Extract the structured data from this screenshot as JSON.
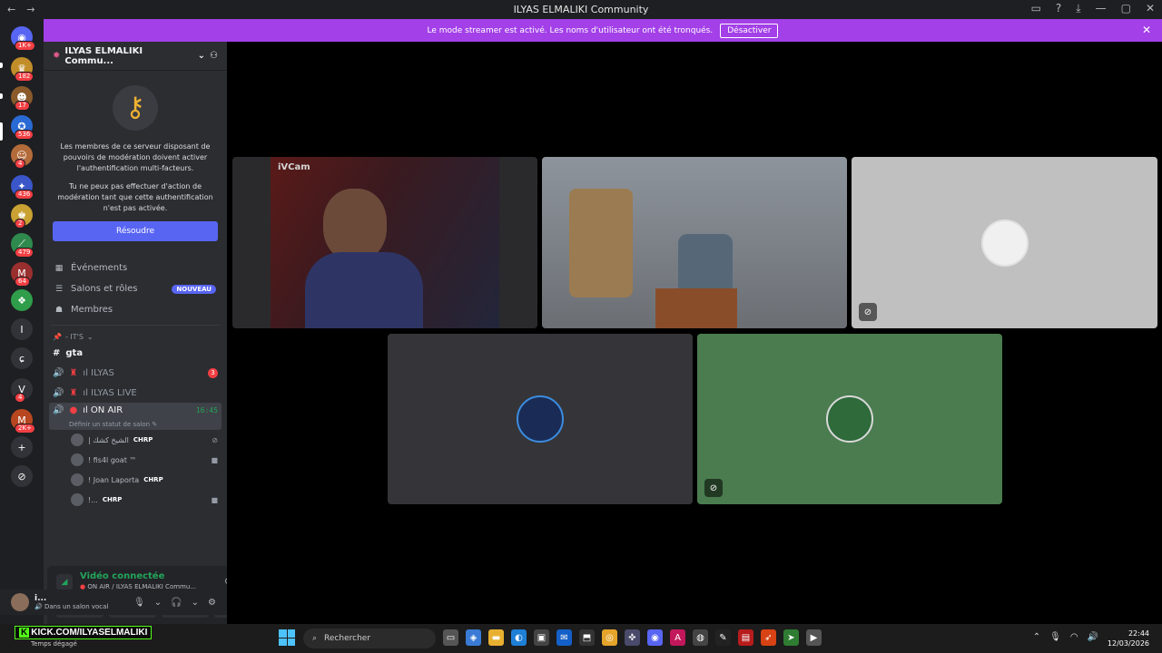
{
  "window": {
    "title": "ILYAS ELMALIKI Community",
    "nav_back": "←",
    "nav_forward": "→",
    "controls": [
      "▭",
      "?",
      "⤓",
      "—",
      "▢",
      "✕"
    ]
  },
  "banner": {
    "text": "Le mode streamer est activé. Les noms d'utilisateur ont été tronqués.",
    "button": "Désactiver",
    "close": "✕"
  },
  "servers": [
    {
      "badge": "1K+",
      "color": "#5865f2",
      "glyph": "◉"
    },
    {
      "badge": "182",
      "color": "#c28e2a",
      "glyph": "♛"
    },
    {
      "badge": "17",
      "color": "#8a5a2b",
      "glyph": "☻"
    },
    {
      "badge": "536",
      "color": "#2a6ad4",
      "glyph": "✪"
    },
    {
      "badge": "4",
      "color": "#b46b3a",
      "glyph": "☺"
    },
    {
      "badge": "436",
      "color": "#3b56c8",
      "glyph": "✦"
    },
    {
      "badge": "2",
      "color": "#c9a233",
      "glyph": "♚"
    },
    {
      "badge": "479",
      "color": "#2f8a4e",
      "glyph": "⟋"
    },
    {
      "badge": "64",
      "color": "#9a2f2f",
      "glyph": "M"
    },
    {
      "badge": "",
      "color": "#2f9d4a",
      "glyph": "❖"
    },
    {
      "badge": "",
      "color": "#313338",
      "glyph": "I"
    },
    {
      "badge": "",
      "color": "#313338",
      "glyph": "ɕ"
    },
    {
      "badge": "4",
      "color": "#313338",
      "glyph": "V"
    },
    {
      "badge": "2K+",
      "color": "#b8471f",
      "glyph": "M"
    },
    {
      "badge": "",
      "color": "#313338",
      "glyph": "+"
    },
    {
      "badge": "",
      "color": "#313338",
      "glyph": "⊘"
    }
  ],
  "guild": {
    "name": "ILYAS ELMALIKI Commu...",
    "mfa_text_1": "Les membres de ce serveur disposant de pouvoirs de modération doivent activer l'authentification multi-facteurs.",
    "mfa_text_2": "Tu ne peux pas effectuer d'action de modération tant que cette authentification n'est pas activée.",
    "resolve_button": "Résoudre"
  },
  "nav": {
    "events": "Événements",
    "channels_roles": "Salons et rôles",
    "new_badge": "NOUVEAU",
    "members": "Membres"
  },
  "category": "- IT'S",
  "channels": [
    {
      "name": "gta",
      "type": "text"
    },
    {
      "name": "ıl ILYAS",
      "type": "voice",
      "mention": "3"
    },
    {
      "name": "ıl ILYAS LIVE",
      "type": "voice"
    },
    {
      "name": "ıl ON AIR",
      "type": "voice",
      "time": "16:45",
      "status": "Définir un statut de salon ✎"
    }
  ],
  "voice_users": [
    {
      "name": "| الشيخ كشك",
      "tag": "CHRP",
      "trail": "⊘"
    },
    {
      "name": "! fis4l goat ™",
      "tag": "",
      "trail": "■"
    },
    {
      "name": "! Joan Laporta",
      "tag": "CHRP",
      "trail": ""
    },
    {
      "name": "!...",
      "tag": "CHRP",
      "trail": "■"
    }
  ],
  "connection": {
    "status": "Vidéo connectée",
    "channel": "ON AIR / ILYAS ELMALIKI Commu...",
    "buttons": [
      "■",
      "▣",
      "✣",
      "✺"
    ]
  },
  "user": {
    "name": "i...",
    "status": "Dans un salon vocal"
  },
  "video_tiles": [
    {
      "label": "iVCam"
    },
    {
      "label": ""
    },
    {
      "label": ""
    },
    {
      "label": ""
    },
    {
      "label": ""
    }
  ],
  "taskbar": {
    "kick_text": "KICK.COM/ILYASELMALIKI",
    "weather": "Temps dégagé",
    "search": "Rechercher",
    "time": "22:44",
    "date": "12/03/2026"
  }
}
